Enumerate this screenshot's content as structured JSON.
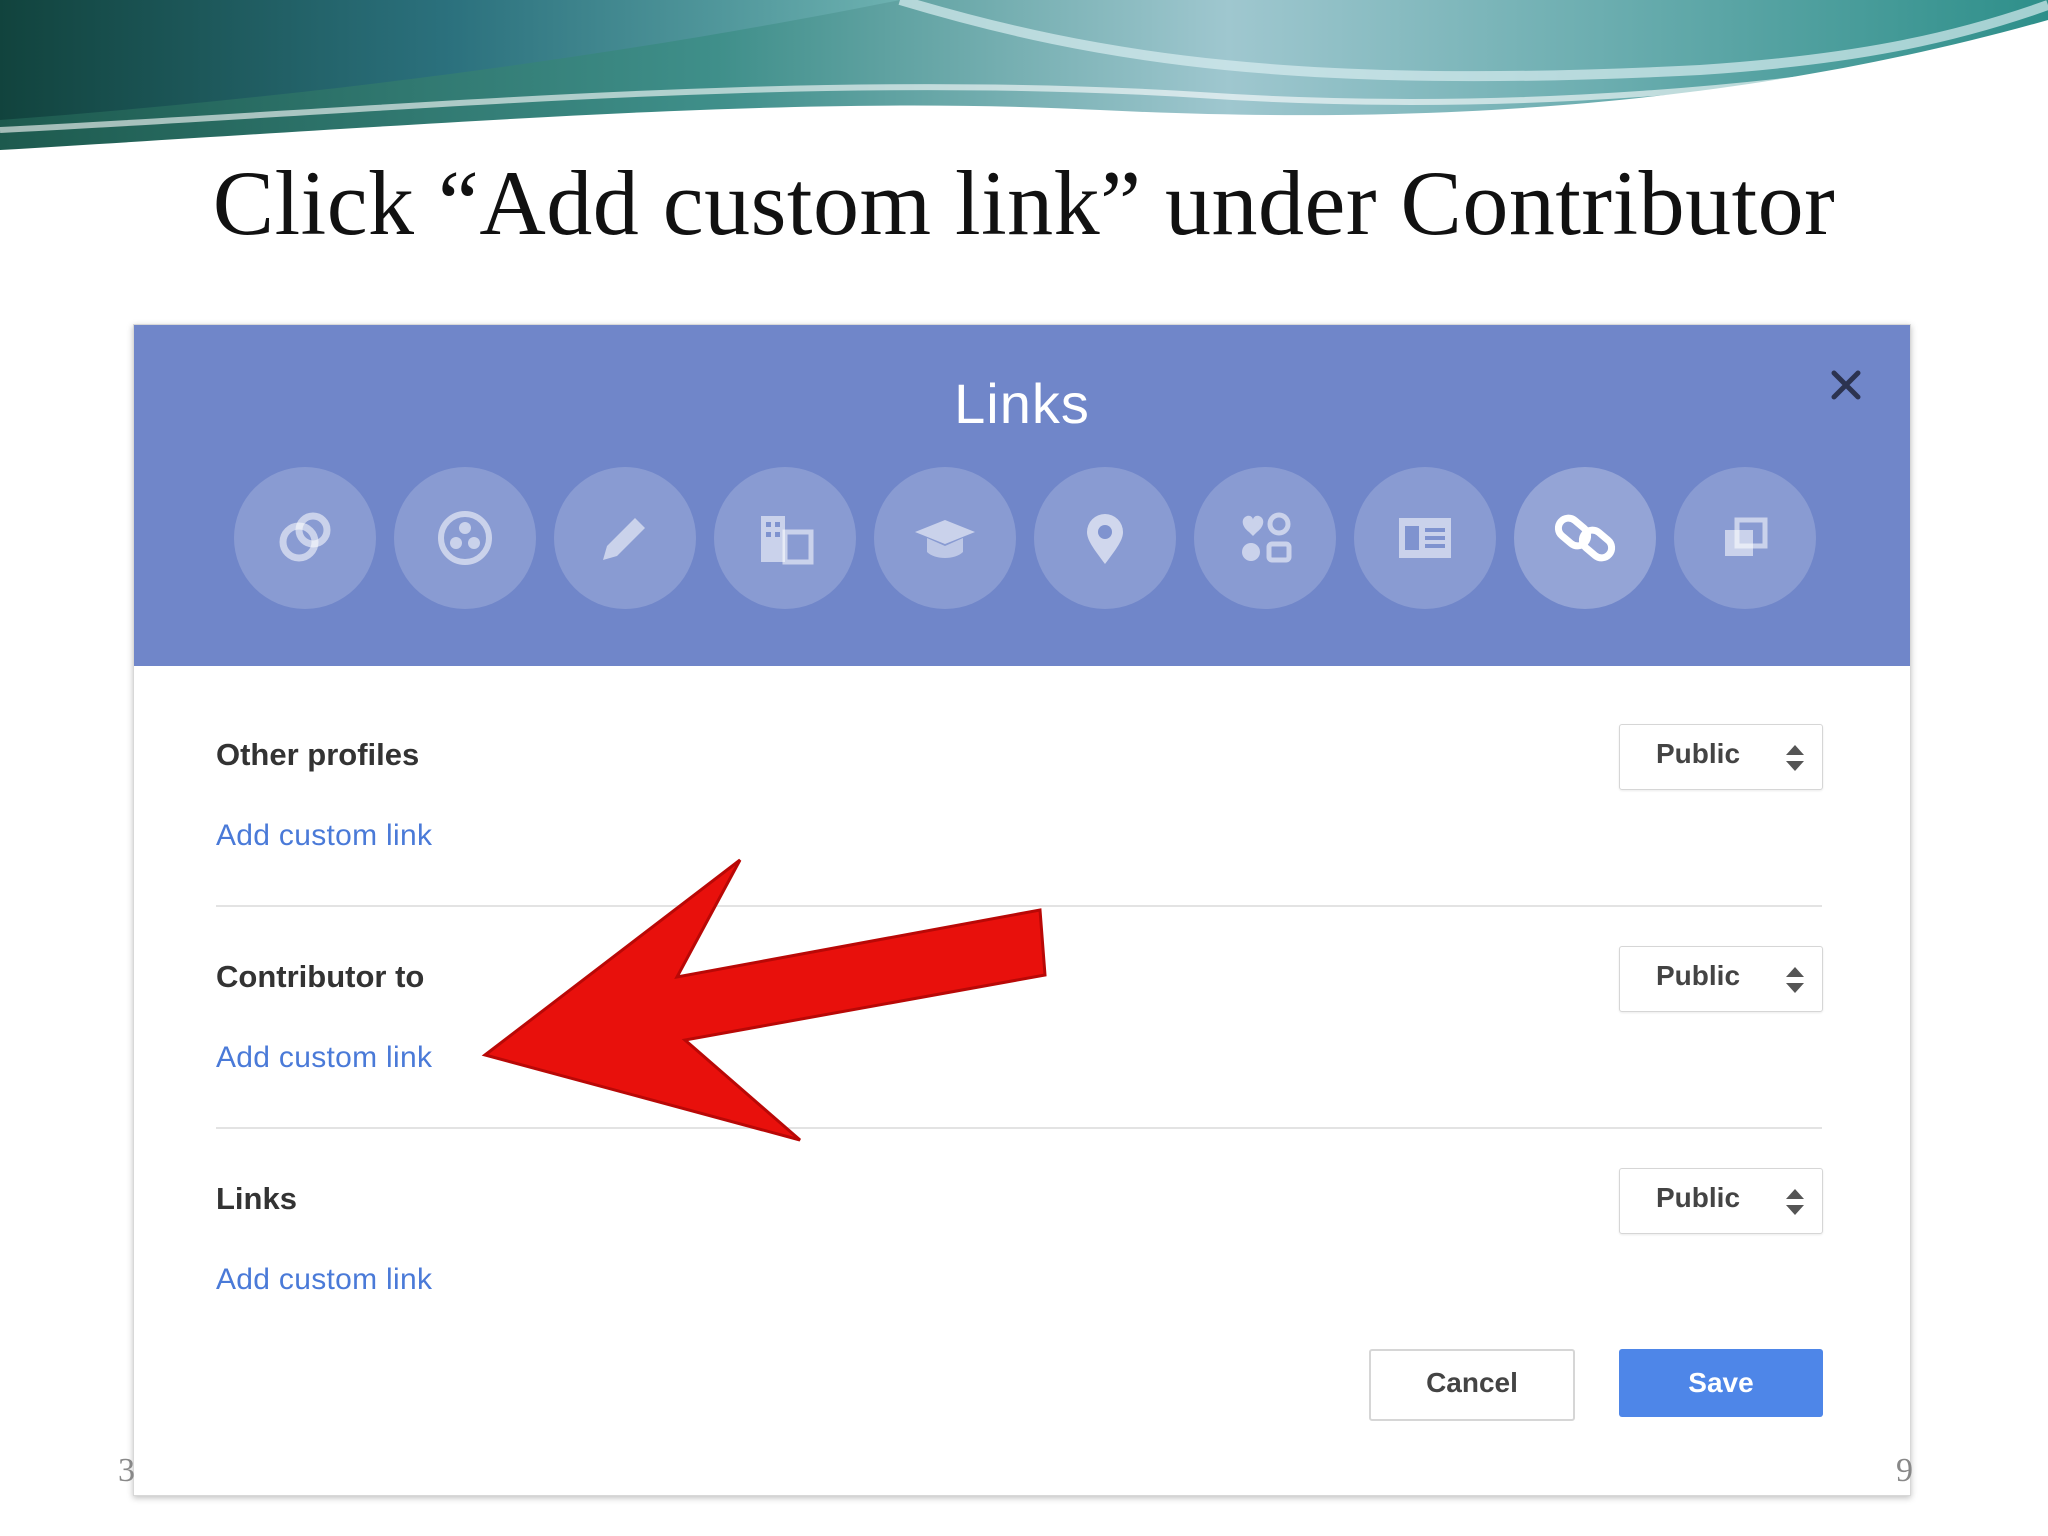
{
  "slide": {
    "title": "Click “Add custom link” under Contributor",
    "number_left": "3",
    "number_right": "9"
  },
  "dialog": {
    "title": "Links",
    "tabs": [
      {
        "icon": "intro-icon"
      },
      {
        "icon": "story-icon"
      },
      {
        "icon": "pencil-icon"
      },
      {
        "icon": "work-icon"
      },
      {
        "icon": "education-icon"
      },
      {
        "icon": "places-icon"
      },
      {
        "icon": "basic-info-icon"
      },
      {
        "icon": "contact-info-icon"
      },
      {
        "icon": "links-icon",
        "active": true
      },
      {
        "icon": "other-icon"
      }
    ],
    "sections": [
      {
        "label": "Other profiles",
        "add_link": "Add custom link",
        "visibility": "Public"
      },
      {
        "label": "Contributor to",
        "add_link": "Add custom link",
        "visibility": "Public"
      },
      {
        "label": "Links",
        "add_link": "Add custom link",
        "visibility": "Public"
      }
    ],
    "cancel_label": "Cancel",
    "save_label": "Save"
  },
  "colors": {
    "header": "#7086c9",
    "link": "#4a7ad8",
    "save": "#4e86e8",
    "arrow": "#e8100c"
  }
}
